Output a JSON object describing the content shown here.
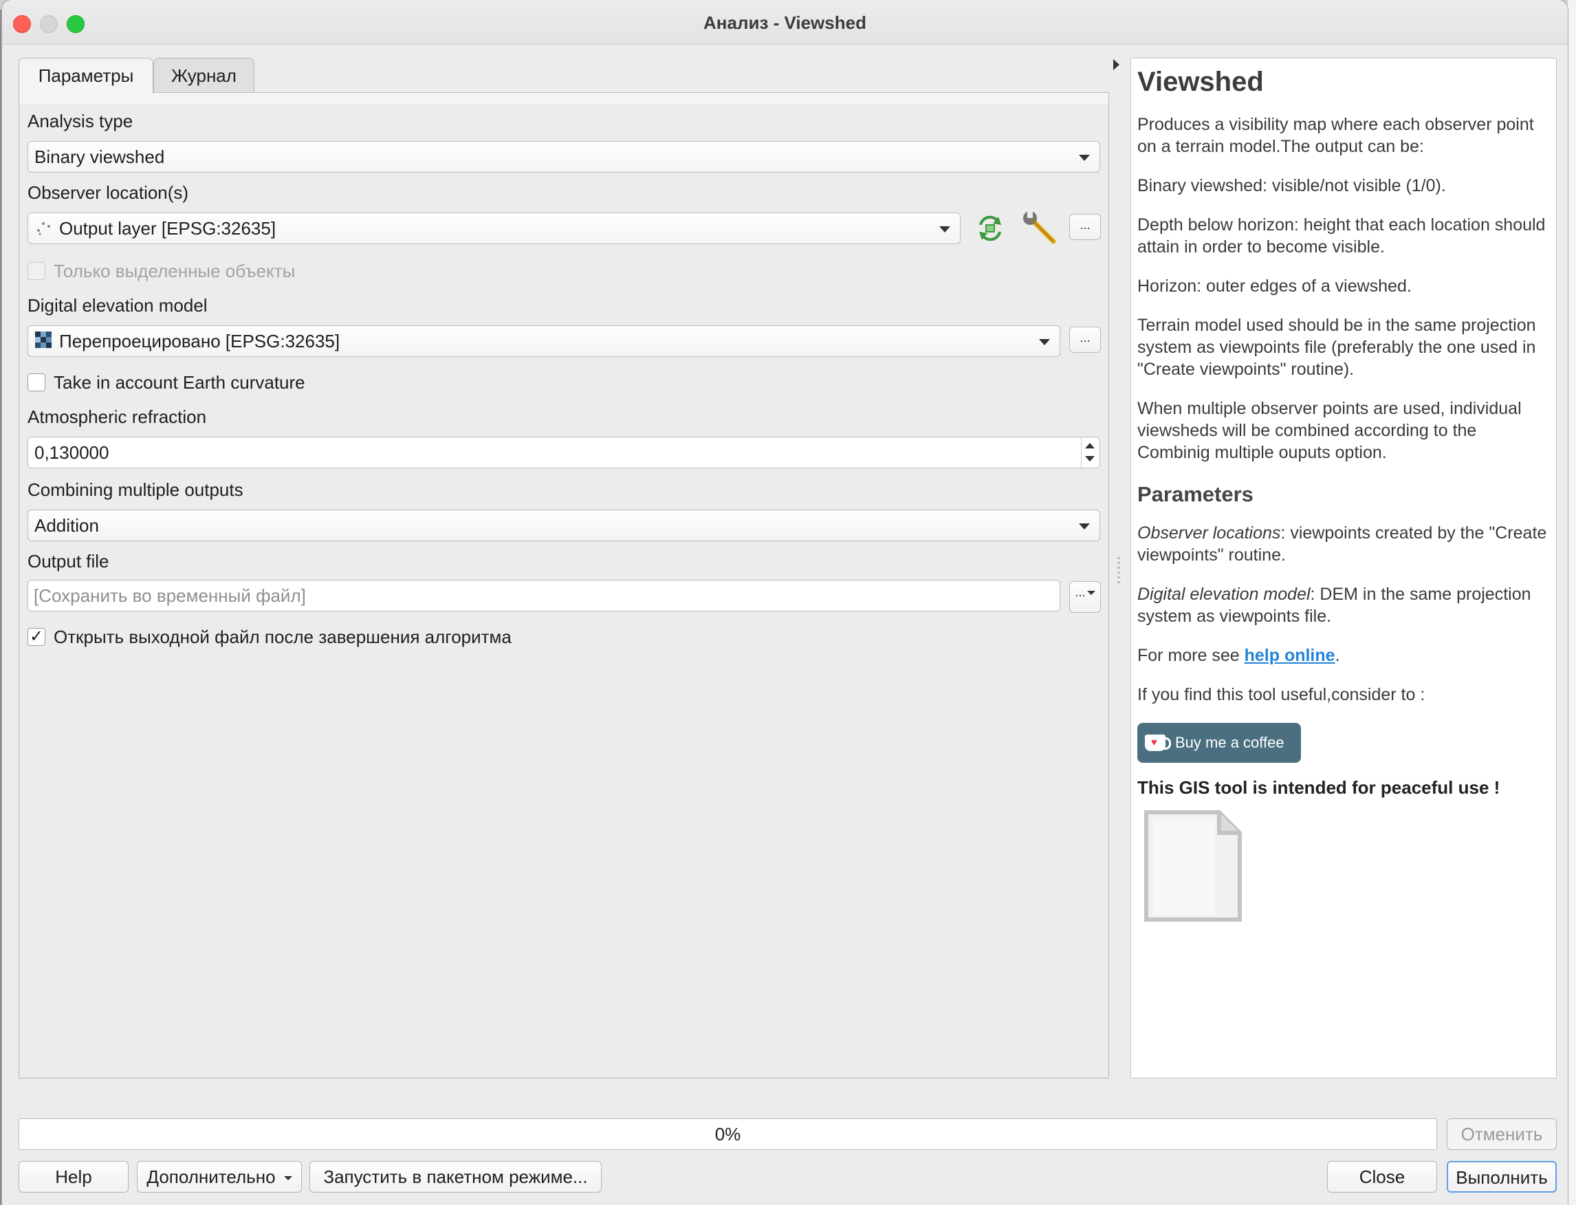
{
  "window": {
    "title": "Анализ - Viewshed"
  },
  "tabs": [
    {
      "label": "Параметры",
      "active": true
    },
    {
      "label": "Журнал",
      "active": false
    }
  ],
  "params": {
    "analysis_type": {
      "label": "Analysis type",
      "value": "Binary viewshed"
    },
    "observer": {
      "label": "Observer location(s)",
      "value": "Output layer [EPSG:32635]",
      "selected_only_label": "Только выделенные объекты",
      "selected_only_checked": false,
      "selected_only_enabled": false
    },
    "dem": {
      "label": "Digital elevation model",
      "value": "Перепроецировано [EPSG:32635]"
    },
    "curvature": {
      "label": "Take in account Earth curvature",
      "checked": false
    },
    "refraction": {
      "label": "Atmospheric refraction",
      "value": "0,130000"
    },
    "combining": {
      "label": "Combining multiple outputs",
      "value": "Addition"
    },
    "output": {
      "label": "Output file",
      "placeholder": "[Сохранить во временный файл]",
      "open_after_label": "Открыть выходной файл после завершения алгоритма",
      "open_after_checked": true
    },
    "dots_label": "..."
  },
  "help": {
    "title": "Viewshed",
    "intro": "Produces a visibility map where each observer point on a terrain model.The output can be:",
    "binary": "Binary viewshed: visible/not visible (1/0).",
    "depth": "Depth below horizon: height that each location should attain in order to become visible.",
    "horizon": "Horizon: outer edges of a viewshed.",
    "terrain": "Terrain model used should be in the same projection system as viewpoints file (preferably the one used in \"Create viewpoints\" routine).",
    "multiple": "When multiple observer points are used, individual viewsheds will be combined according to the Combinig multiple ouputs option.",
    "params_heading": "Parameters",
    "obs_term": "Observer locations",
    "obs_desc": ": viewpoints created by the \"Create viewpoints\" routine.",
    "dem_term": "Digital elevation model",
    "dem_desc": ": DEM in the same projection system as viewpoints file.",
    "more_prefix": "For more see ",
    "more_link": "help online",
    "more_suffix": ".",
    "consider": "If you find this tool useful,consider to :",
    "coffee": "Buy me a coffee",
    "peace": "This GIS tool is intended for peaceful use !"
  },
  "footer": {
    "progress_text": "0%",
    "progress": 0,
    "cancel": "Отменить",
    "help": "Help",
    "advanced": "Дополнительно",
    "batch": "Запустить в пакетном режиме...",
    "close": "Close",
    "run": "Выполнить"
  },
  "colors": {
    "accent": "#5e9fe6",
    "link": "#2384d8",
    "coffee_bg": "#4b6f80",
    "close_dot": "#fe5f57",
    "zoom_dot": "#28c840"
  }
}
